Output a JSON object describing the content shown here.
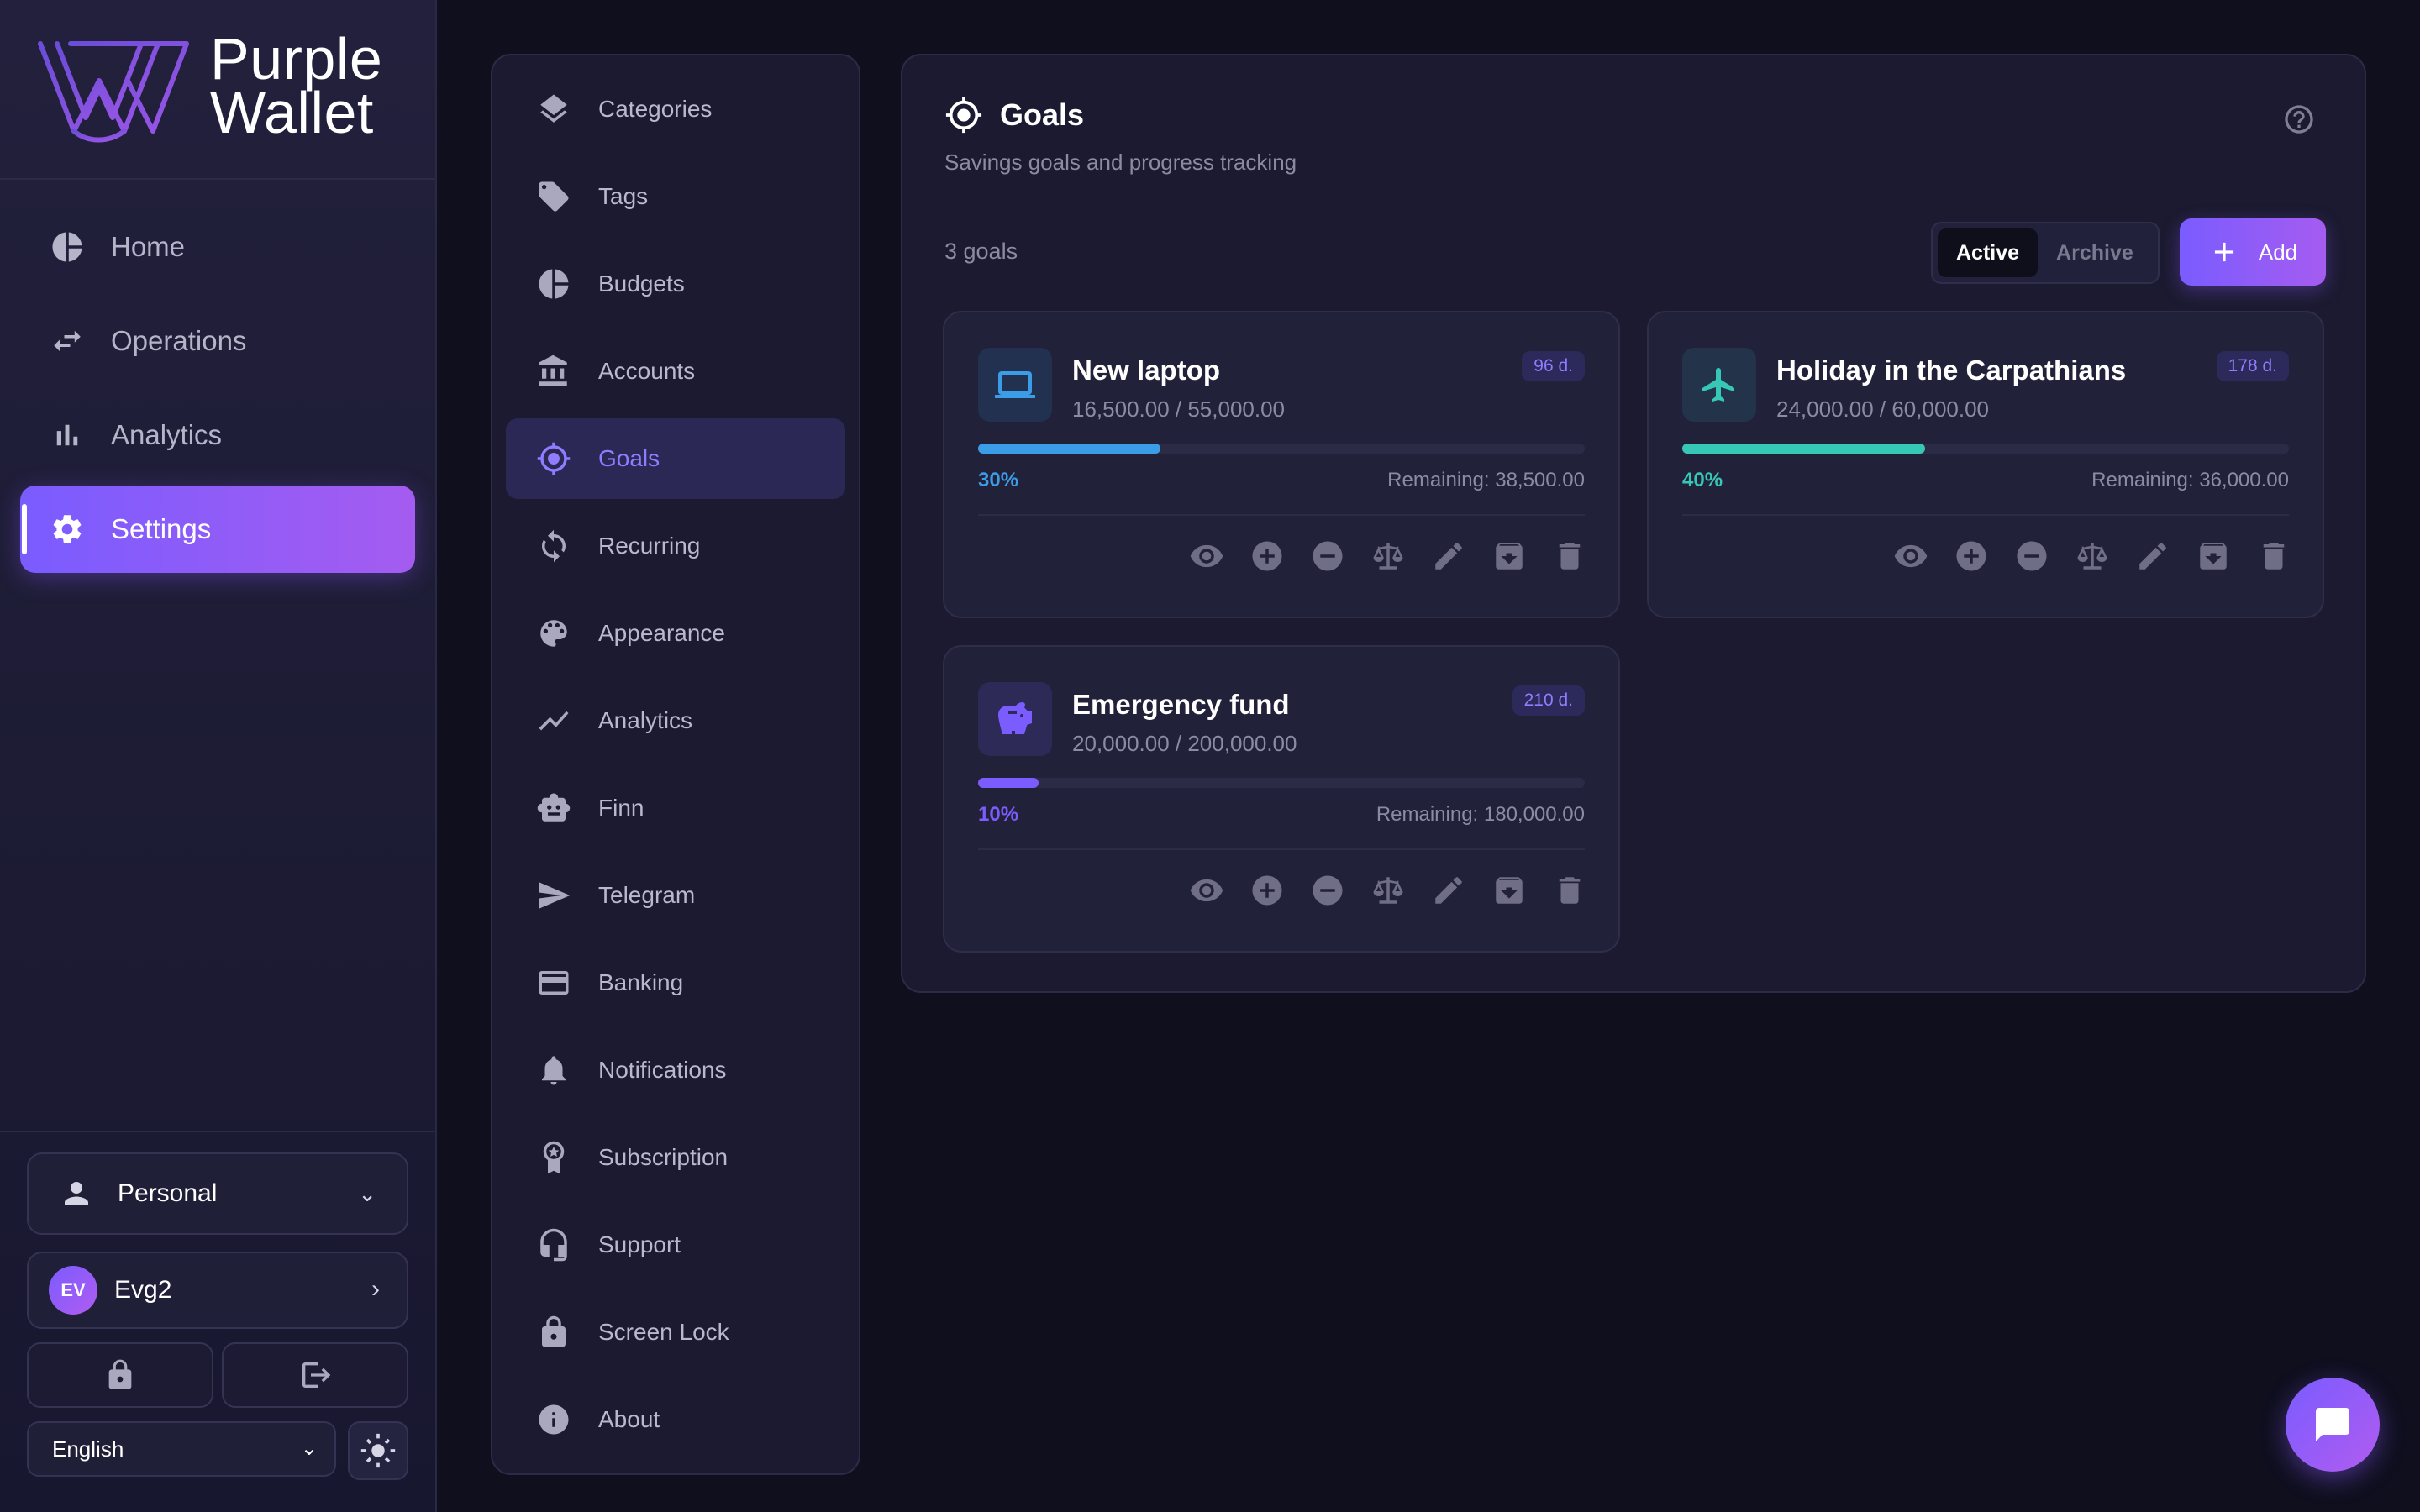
{
  "app": {
    "brand_line1": "Purple",
    "brand_line2": "Wallet"
  },
  "nav": [
    {
      "label": "Home",
      "icon": "pie-chart-icon"
    },
    {
      "label": "Operations",
      "icon": "swap-arrows-icon"
    },
    {
      "label": "Analytics",
      "icon": "bar-chart-icon"
    },
    {
      "label": "Settings",
      "icon": "gear-icon",
      "active": true
    }
  ],
  "profile": {
    "label": "Personal",
    "chevron": "⌄"
  },
  "user": {
    "initials": "EV",
    "name": "Evg2",
    "chevron": "›"
  },
  "language": {
    "selected": "English",
    "chevron": "⌄"
  },
  "settings_menu": [
    {
      "label": "Categories",
      "icon": "layers-icon"
    },
    {
      "label": "Tags",
      "icon": "tag-icon"
    },
    {
      "label": "Budgets",
      "icon": "pie-chart-icon"
    },
    {
      "label": "Accounts",
      "icon": "bank-icon"
    },
    {
      "label": "Goals",
      "icon": "target-icon",
      "active": true
    },
    {
      "label": "Recurring",
      "icon": "refresh-icon"
    },
    {
      "label": "Appearance",
      "icon": "palette-icon"
    },
    {
      "label": "Analytics",
      "icon": "trend-icon"
    },
    {
      "label": "Finn",
      "icon": "robot-icon"
    },
    {
      "label": "Telegram",
      "icon": "send-icon"
    },
    {
      "label": "Banking",
      "icon": "card-icon"
    },
    {
      "label": "Notifications",
      "icon": "bell-icon"
    },
    {
      "label": "Subscription",
      "icon": "award-icon"
    },
    {
      "label": "Support",
      "icon": "headset-icon"
    },
    {
      "label": "Screen Lock",
      "icon": "lock-icon"
    },
    {
      "label": "About",
      "icon": "info-icon"
    }
  ],
  "goals": {
    "title": "Goals",
    "subtitle": "Savings goals and progress tracking",
    "count": "3 goals",
    "tabs": {
      "active": "Active",
      "archive": "Archive"
    },
    "add_label": "Add",
    "items": [
      {
        "name": "New laptop",
        "amount": "16,500.00 / 55,000.00",
        "days": "96 d.",
        "percent_label": "30%",
        "progress": 0.3,
        "remaining": "Remaining: 38,500.00",
        "color": "#3b9de8",
        "icon_bg": "#233150",
        "icon": "laptop-icon"
      },
      {
        "name": "Holiday in the Carpathians",
        "amount": "24,000.00 / 60,000.00",
        "days": "178 d.",
        "percent_label": "40%",
        "progress": 0.4,
        "remaining": "Remaining: 36,000.00",
        "color": "#36c7b6",
        "icon_bg": "#23344a",
        "icon": "airplane-icon"
      },
      {
        "name": "Emergency fund",
        "amount": "20,000.00 / 200,000.00",
        "days": "210 d.",
        "percent_label": "10%",
        "progress": 0.1,
        "remaining": "Remaining: 180,000.00",
        "color": "#7a5cff",
        "icon_bg": "#2d2a58",
        "icon": "piggy-bank-icon"
      }
    ]
  },
  "colors": {
    "accent": "#7a5cff",
    "accent_end": "#a55cf0",
    "background": "#0f0f1e"
  }
}
